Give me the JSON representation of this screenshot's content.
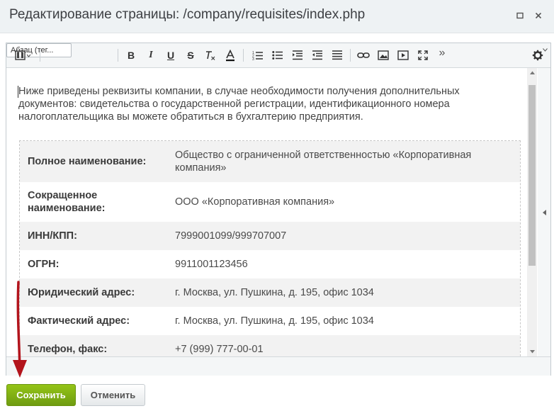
{
  "dialog": {
    "title": "Редактирование страницы: /company/requisites/index.php"
  },
  "toolbar": {
    "paragraph_style": "Абзац (тег...",
    "bold_label": "B",
    "italic_label": "I",
    "underline_label": "U",
    "strike_label": "S",
    "more_label": "»"
  },
  "content": {
    "intro": "Ниже приведены реквизиты компании, в случае необходимости получения дополнительных документов: свидетельства о государственной регистрации, идентификационного номера налогоплательщика вы можете обратиться в бухгалтерию предприятия.",
    "rows": [
      {
        "label": "Полное наименование:",
        "value": "Общество с ограниченной ответственностью «Корпоративная компания»"
      },
      {
        "label": "Сокращенное наименование:",
        "value": "ООО «Корпоративная компания»"
      },
      {
        "label": "ИНН/КПП:",
        "value": "7999001099/999707007"
      },
      {
        "label": "ОГРН:",
        "value": "9911001123456"
      },
      {
        "label": "Юридический адрес:",
        "value": "г. Москва, ул. Пушкина, д. 195, офис 1034"
      },
      {
        "label": "Фактический адрес:",
        "value": "г. Москва, ул. Пушкина, д. 195, офис 1034"
      },
      {
        "label": "Телефон, факс:",
        "value": "+7 (999) 777-00-01"
      }
    ]
  },
  "footer": {
    "save_label": "Сохранить",
    "cancel_label": "Отменить"
  },
  "colors": {
    "save_button": "#7fb015",
    "annotation_arrow": "#b3141c",
    "titlebar_bg": "#eef2f4"
  }
}
